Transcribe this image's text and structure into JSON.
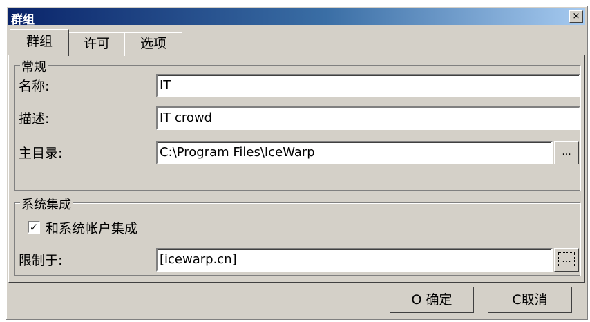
{
  "window": {
    "title": "群组",
    "close_glyph": "×"
  },
  "tabs": [
    {
      "label": "群组",
      "active": true
    },
    {
      "label": "许可",
      "active": false
    },
    {
      "label": "选项",
      "active": false
    }
  ],
  "general": {
    "legend": "常规",
    "name_label": "名称:",
    "name_value": "IT",
    "desc_label": "描述:",
    "desc_value": "IT crowd",
    "home_label": "主目录:",
    "home_value": "C:\\Program Files\\IceWarp",
    "browse_label": "..."
  },
  "system": {
    "legend": "系统集成",
    "checkbox_label": "和系统帐户集成",
    "checkbox_checked": true,
    "checkbox_mark": "✓",
    "limit_label": "限制于:",
    "limit_value": "[icewarp.cn]",
    "browse_label": "..."
  },
  "buttons": {
    "ok_key": "O",
    "ok_label": "确定",
    "cancel_key": "C",
    "cancel_label": "取消"
  }
}
